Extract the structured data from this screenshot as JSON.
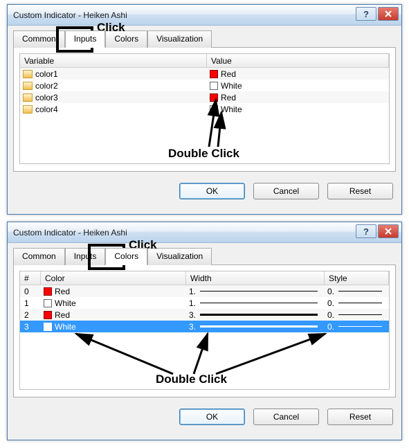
{
  "dialog1": {
    "title": "Custom Indicator - Heiken Ashi",
    "tabs": {
      "common": "Common",
      "inputs": "Inputs",
      "colors": "Colors",
      "visualization": "Visualization"
    },
    "headers": {
      "variable": "Variable",
      "value": "Value"
    },
    "rows": [
      {
        "name": "color1",
        "value": "Red",
        "swatch": "red"
      },
      {
        "name": "color2",
        "value": "White",
        "swatch": "white"
      },
      {
        "name": "color3",
        "value": "Red",
        "swatch": "red"
      },
      {
        "name": "color4",
        "value": "White",
        "swatch": "white"
      }
    ],
    "buttons": {
      "ok": "OK",
      "cancel": "Cancel",
      "reset": "Reset"
    }
  },
  "dialog2": {
    "title": "Custom Indicator - Heiken Ashi",
    "tabs": {
      "common": "Common",
      "inputs": "Inputs",
      "colors": "Colors",
      "visualization": "Visualization"
    },
    "headers": {
      "num": "#",
      "color": "Color",
      "width": "Width",
      "style": "Style"
    },
    "rows": [
      {
        "idx": "0",
        "color": "Red",
        "swatch": "red",
        "width": "1.",
        "wborder": 1,
        "style": "0."
      },
      {
        "idx": "1",
        "color": "White",
        "swatch": "white",
        "width": "1.",
        "wborder": 1,
        "style": "0."
      },
      {
        "idx": "2",
        "color": "Red",
        "swatch": "red",
        "width": "3.",
        "wborder": 3,
        "style": "0."
      },
      {
        "idx": "3",
        "color": "White",
        "swatch": "white",
        "width": "3.",
        "wborder": 3,
        "style": "0.",
        "selected": true
      }
    ],
    "buttons": {
      "ok": "OK",
      "cancel": "Cancel",
      "reset": "Reset"
    }
  },
  "annotations": {
    "click": "Click",
    "double_click": "Double Click"
  }
}
